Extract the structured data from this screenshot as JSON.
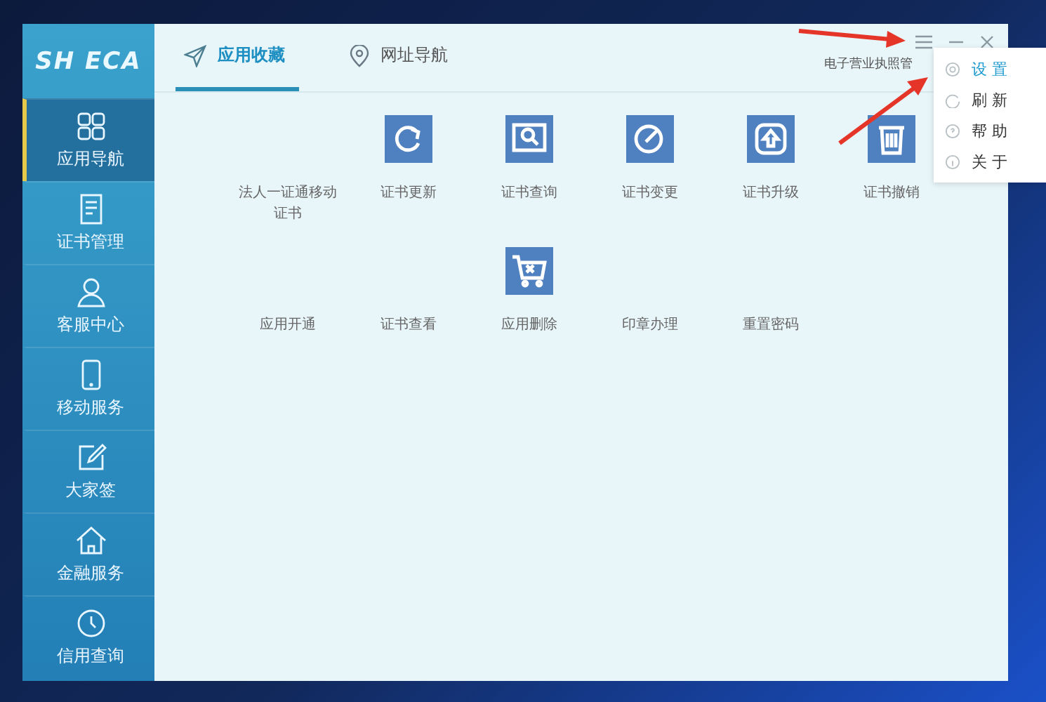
{
  "sidebar": {
    "logo": "SH ECA",
    "items": [
      {
        "label": "应用导航",
        "kind": "grid",
        "selected": true
      },
      {
        "label": "证书管理",
        "kind": "document",
        "selected": false
      },
      {
        "label": "客服中心",
        "kind": "person",
        "selected": false
      },
      {
        "label": "移动服务",
        "kind": "phone",
        "selected": false
      },
      {
        "label": "大家签",
        "kind": "pen",
        "selected": false
      },
      {
        "label": "金融服务",
        "kind": "house",
        "selected": false
      },
      {
        "label": "信用查询",
        "kind": "clock",
        "selected": false
      }
    ]
  },
  "tabs": [
    {
      "label": "应用收藏",
      "kind": "send",
      "selected": true
    },
    {
      "label": "网址导航",
      "kind": "pin",
      "selected": false
    }
  ],
  "header_link": "电子营业执照管",
  "apps": [
    {
      "label": "法人一证通移动证书",
      "kind": "text"
    },
    {
      "label": "证书更新",
      "kind": "refresh"
    },
    {
      "label": "证书查询",
      "kind": "search"
    },
    {
      "label": "证书变更",
      "kind": "edit"
    },
    {
      "label": "证书升级",
      "kind": "upgrade"
    },
    {
      "label": "证书撤销",
      "kind": "trash"
    },
    {
      "label": "应用开通",
      "kind": "text"
    },
    {
      "label": "证书查看",
      "kind": "text"
    },
    {
      "label": "应用删除",
      "kind": "cart"
    },
    {
      "label": "印章办理",
      "kind": "text"
    },
    {
      "label": "重置密码",
      "kind": "text"
    }
  ],
  "menu": [
    {
      "label": "设 置",
      "kind": "gear",
      "selected": true
    },
    {
      "label": "刷 新",
      "kind": "refresh",
      "selected": false
    },
    {
      "label": "帮 助",
      "kind": "help",
      "selected": false
    },
    {
      "label": "关 于",
      "kind": "info",
      "selected": false
    }
  ]
}
